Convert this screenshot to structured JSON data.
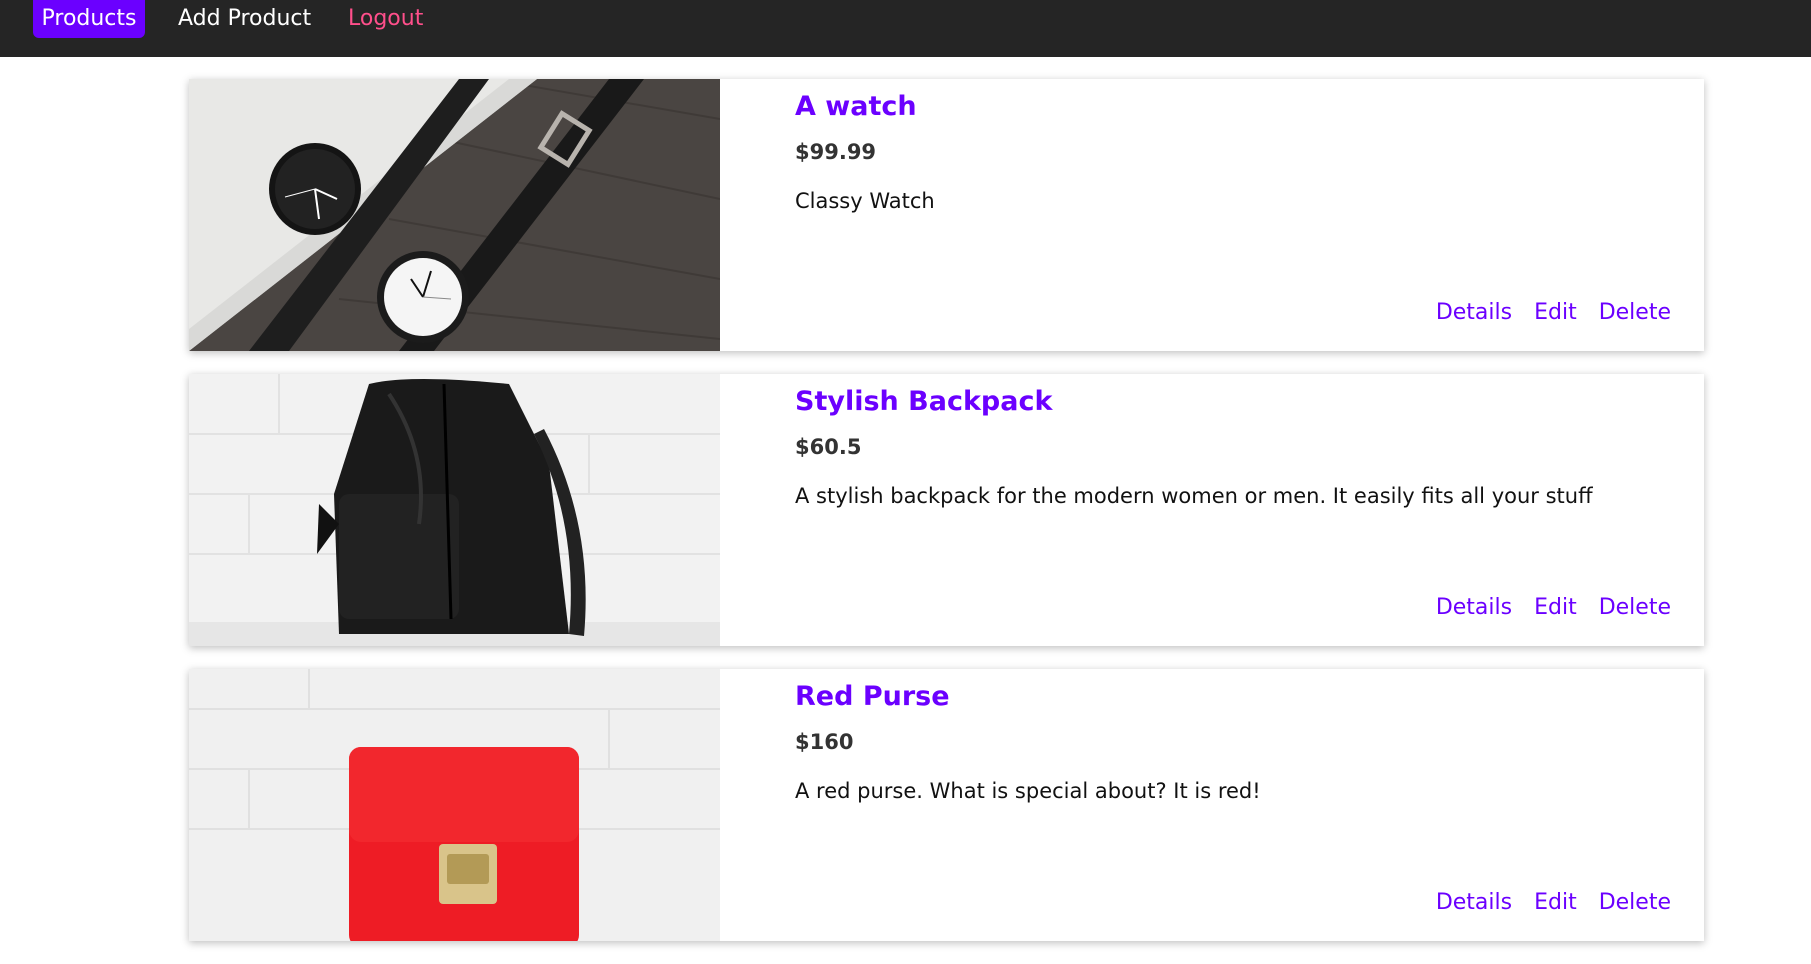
{
  "nav": {
    "products_label": "Products",
    "add_product_label": "Add Product",
    "logout_label": "Logout"
  },
  "colors": {
    "accent": "#6b00ff",
    "navbar_bg": "#252525",
    "logout": "#ff4f8b"
  },
  "products": [
    {
      "title": "A watch",
      "price": "$99.99",
      "description": "Classy Watch",
      "image": "watch-photo",
      "actions": {
        "details": "Details",
        "edit": "Edit",
        "delete": "Delete"
      }
    },
    {
      "title": "Stylish Backpack",
      "price": "$60.5",
      "description": "A stylish backpack for the modern women or men. It easily fits all your stuff",
      "image": "backpack-photo",
      "actions": {
        "details": "Details",
        "edit": "Edit",
        "delete": "Delete"
      }
    },
    {
      "title": "Red Purse",
      "price": "$160",
      "description": "A red purse. What is special about? It is red!",
      "image": "purse-photo",
      "actions": {
        "details": "Details",
        "edit": "Edit",
        "delete": "Delete"
      }
    }
  ]
}
